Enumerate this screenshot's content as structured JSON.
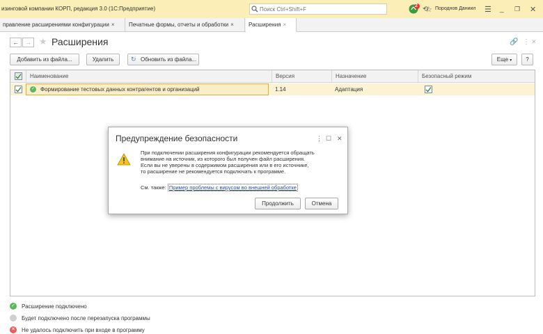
{
  "window": {
    "title": "изинговой компании КОРП, редакция 3.0  (1С:Предприятие)",
    "search_placeholder": "Поиск Ctrl+Shift+F",
    "user": "Породнов Даниил",
    "notification_count": "2",
    "accent": "#fbeeb6"
  },
  "tabs": [
    {
      "label": "правление расширениями конфигурации",
      "close": "×"
    },
    {
      "label": "Печатные формы, отчеты и обработки",
      "close": "×"
    },
    {
      "label": "Расширения",
      "close": "×"
    }
  ],
  "form": {
    "title": "Расширения",
    "back": "←",
    "forward": "→",
    "toolbar": {
      "add": "Добавить из файла...",
      "delete": "Удалить",
      "update": "Обновить из файла...",
      "more": "Еще",
      "help": "?"
    }
  },
  "table": {
    "columns": [
      "Наименование",
      "Версия",
      "Назначение",
      "Безопасный режим"
    ],
    "rows": [
      {
        "name": "Формирование тестовых данных контрагентов и организаций",
        "version": "1.14",
        "purpose": "Адаптация",
        "safe_mode": true,
        "checked": true
      }
    ]
  },
  "dialog": {
    "title": "Предупреждение безопасности",
    "line1": "При подключении расширения конфигурации рекомендуется обращать",
    "line2": "внимание на источник, из которого был получен файл расширения.",
    "line3": "Если вы не уверены в содержимом расширения или в его источнике,",
    "line4": "то расширение не рекомендуется подключать к программе.",
    "see_also": "См. также:",
    "link": "Пример проблемы с вирусом во внешней обработке",
    "continue": "Продолжить",
    "cancel": "Отмена"
  },
  "legend": [
    {
      "label": "Расширение подключено",
      "color": "#5cb85c"
    },
    {
      "label": "Будет подключено после перезапуска программы",
      "color": "#cfcfcf"
    },
    {
      "label": "Не удалось подключить при входе в программу",
      "color": "#e85c5c"
    }
  ]
}
